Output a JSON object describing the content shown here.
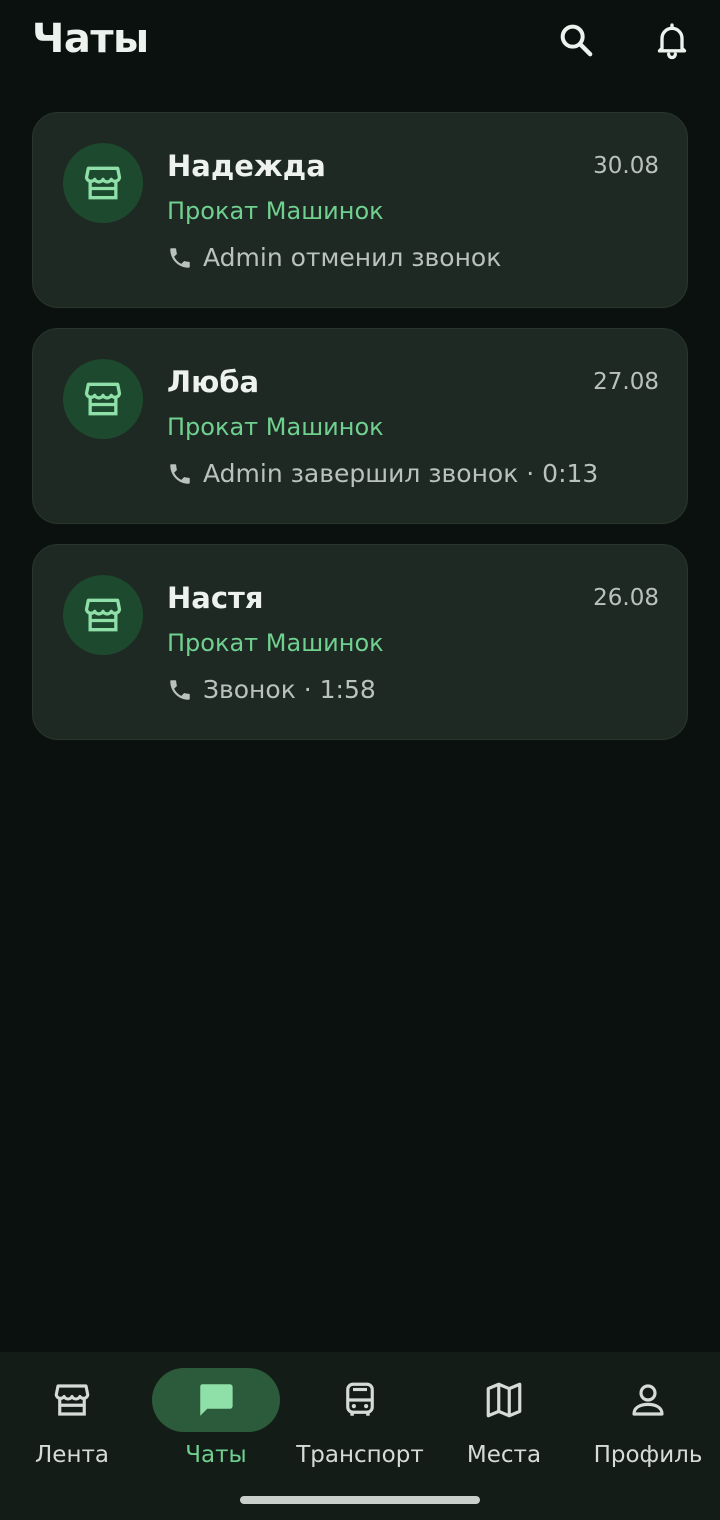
{
  "header": {
    "title": "Чаты",
    "search_icon": "search-icon",
    "bell_icon": "bell-icon"
  },
  "chats": [
    {
      "name": "Надежда",
      "date": "30.08",
      "shop": "Прокат Машинок",
      "last_message": "Admin отменил звонок",
      "avatar_icon": "store-icon",
      "message_icon": "phone-icon"
    },
    {
      "name": "Люба",
      "date": "27.08",
      "shop": "Прокат Машинок",
      "last_message": "Admin завершил звонок · 0:13",
      "avatar_icon": "store-icon",
      "message_icon": "phone-icon"
    },
    {
      "name": "Настя",
      "date": "26.08",
      "shop": "Прокат Машинок",
      "last_message": "Звонок · 1:58",
      "avatar_icon": "store-icon",
      "message_icon": "phone-icon"
    }
  ],
  "bottom_nav": {
    "items": [
      {
        "label": "Лента",
        "icon": "store-icon",
        "active": false
      },
      {
        "label": "Чаты",
        "icon": "chat-bubble-icon",
        "active": true
      },
      {
        "label": "Транспорт",
        "icon": "bus-icon",
        "active": false
      },
      {
        "label": "Места",
        "icon": "map-icon",
        "active": false
      },
      {
        "label": "Профиль",
        "icon": "person-icon",
        "active": false
      }
    ]
  },
  "colors": {
    "background": "#0b110e",
    "card": "#1f2923",
    "accent": "#6fd08f",
    "avatar_bg": "#1d4a2e",
    "active_nav_bg": "#2b5b3a"
  }
}
